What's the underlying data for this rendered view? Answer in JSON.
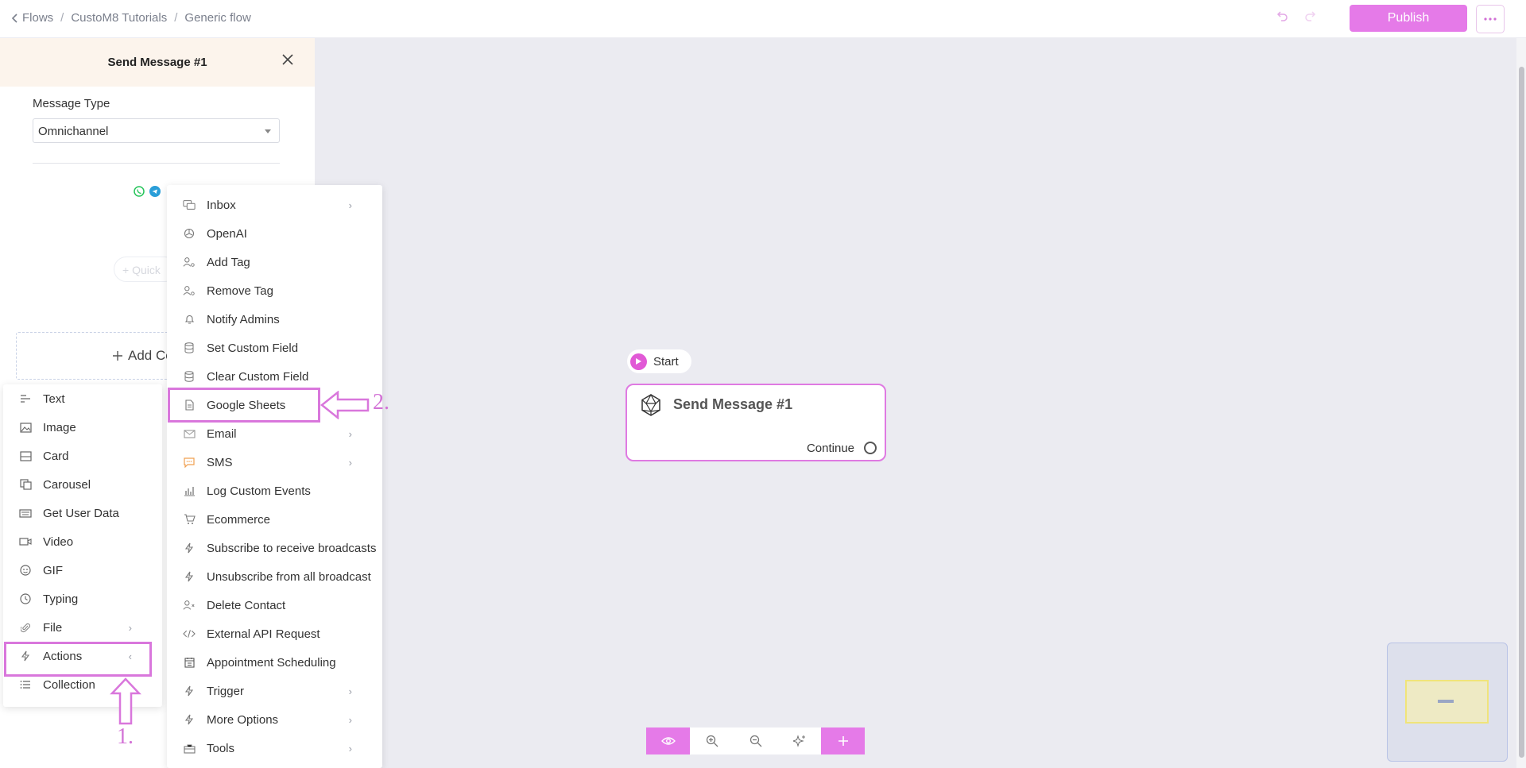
{
  "topbar": {
    "breadcrumb": [
      "Flows",
      "CustoM8 Tutorials",
      "Generic flow"
    ],
    "publish_label": "Publish"
  },
  "side_panel": {
    "title": "Send Message #1",
    "message_type_label": "Message Type",
    "message_type_value": "Omnichannel",
    "quick_reply_label": "+ Quick",
    "add_content_label": "Add Co"
  },
  "content_menu": {
    "items": [
      {
        "label": "Text",
        "icon": "text-lines-icon"
      },
      {
        "label": "Image",
        "icon": "image-icon"
      },
      {
        "label": "Card",
        "icon": "card-icon"
      },
      {
        "label": "Carousel",
        "icon": "carousel-icon"
      },
      {
        "label": "Get User Data",
        "icon": "keyboard-icon"
      },
      {
        "label": "Video",
        "icon": "video-icon"
      },
      {
        "label": "GIF",
        "icon": "gif-icon"
      },
      {
        "label": "Typing",
        "icon": "clock-icon"
      },
      {
        "label": "File",
        "icon": "paperclip-icon",
        "has_submenu": true
      },
      {
        "label": "Actions",
        "icon": "bolt-icon",
        "has_submenu": true,
        "highlighted": true
      },
      {
        "label": "Collection",
        "icon": "list-icon"
      }
    ]
  },
  "actions_menu": {
    "items": [
      {
        "label": "Inbox",
        "icon": "chat-icon",
        "has_submenu": true
      },
      {
        "label": "OpenAI",
        "icon": "openai-icon"
      },
      {
        "label": "Add Tag",
        "icon": "user-tag-icon"
      },
      {
        "label": "Remove Tag",
        "icon": "user-tag-icon"
      },
      {
        "label": "Notify Admins",
        "icon": "bell-icon"
      },
      {
        "label": "Set Custom Field",
        "icon": "database-icon"
      },
      {
        "label": "Clear Custom Field",
        "icon": "database-icon"
      },
      {
        "label": "Google Sheets",
        "icon": "sheet-icon",
        "highlighted": true
      },
      {
        "label": "Email",
        "icon": "mail-icon",
        "has_submenu": true
      },
      {
        "label": "SMS",
        "icon": "sms-icon",
        "has_submenu": true
      },
      {
        "label": "Log Custom Events",
        "icon": "chart-icon"
      },
      {
        "label": "Ecommerce",
        "icon": "cart-icon"
      },
      {
        "label": "Subscribe to receive broadcasts",
        "icon": "bolt-icon"
      },
      {
        "label": "Unsubscribe from all broadcast",
        "icon": "bolt-icon"
      },
      {
        "label": "Delete Contact",
        "icon": "user-remove-icon"
      },
      {
        "label": "External API Request",
        "icon": "code-icon"
      },
      {
        "label": "Appointment Scheduling",
        "icon": "calendar-icon"
      },
      {
        "label": "Trigger",
        "icon": "bolt-icon",
        "has_submenu": true
      },
      {
        "label": "More Options",
        "icon": "bolt-icon",
        "has_submenu": true
      },
      {
        "label": "Tools",
        "icon": "toolbox-icon",
        "has_submenu": true
      }
    ]
  },
  "canvas": {
    "start_label": "Start",
    "node_title": "Send Message #1",
    "node_continue": "Continue"
  },
  "annotations": {
    "step1": "1.",
    "step2": "2."
  },
  "colors": {
    "accent": "#e57ae8",
    "canvas_bg": "#ebebf1",
    "panel_header_bg": "#fcf4ec"
  }
}
